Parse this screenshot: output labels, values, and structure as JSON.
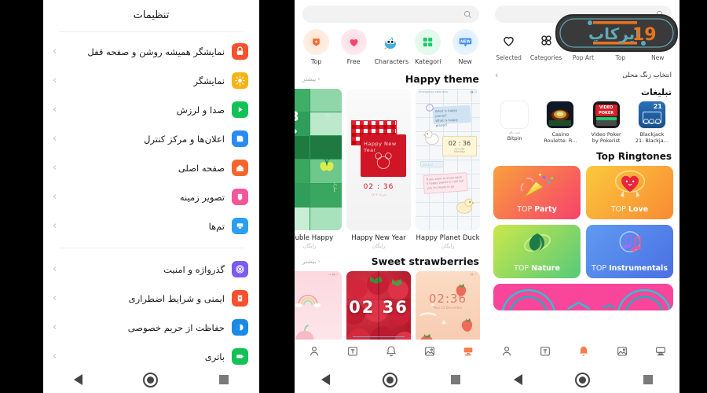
{
  "panel_settings": {
    "title": "تنظیمات",
    "groups": [
      {
        "items": [
          {
            "label": "نمایشگر همیشه روشن و صفحه قفل",
            "icon": "lock-icon",
            "color": "#f4512c"
          },
          {
            "label": "نمایشگر",
            "icon": "brightness-icon",
            "color": "#f5b417"
          },
          {
            "label": "صدا و لرزش",
            "icon": "sound-play-icon",
            "color": "#14c157"
          },
          {
            "label": "اعلان‌ها و مرکز کنترل",
            "icon": "notification-icon",
            "color": "#2a8cf0"
          },
          {
            "label": "صفحه اصلی",
            "icon": "home-icon",
            "color": "#f4662c"
          },
          {
            "label": "تصویر زمینه",
            "icon": "wallpaper-icon",
            "color": "#f4569b"
          },
          {
            "label": "تم‌ها",
            "icon": "themes-icon",
            "color": "#2a9ef0"
          }
        ]
      },
      {
        "items": [
          {
            "label": "گذرواژه و امنیت",
            "icon": "fingerprint-icon",
            "color": "#7b5cf0"
          },
          {
            "label": "ایمنی و شرایط اضطراری",
            "icon": "safety-icon",
            "color": "#f4512c"
          },
          {
            "label": "حفاظت از حریم خصوصی",
            "icon": "privacy-icon",
            "color": "#1a8ae5"
          },
          {
            "label": "باتری",
            "icon": "battery-icon",
            "color": "#14c157"
          }
        ]
      }
    ],
    "system_nav": [
      "back-triangle",
      "home-circle",
      "recents-square"
    ]
  },
  "panel_themes": {
    "search_placeholder": "",
    "search_icon": "search-icon",
    "categories": [
      {
        "label": "Top",
        "icon": "top-badge-icon",
        "color": "#f4662c"
      },
      {
        "label": "Free",
        "icon": "heart-icon",
        "color": "#f2456b"
      },
      {
        "label": "Characters",
        "icon": "bird-icon",
        "color": "#3fb0e8"
      },
      {
        "label": "Kategori",
        "icon": "grid-icon",
        "color": "#1ec96a"
      },
      {
        "label": "New",
        "icon": "new-badge-icon",
        "color": "#3a8ce8"
      }
    ],
    "sections": [
      {
        "title": "Happy theme",
        "more_label": "بیشتر",
        "items": [
          {
            "name": "Double Happy",
            "price": "رایگان",
            "art": "green-grid"
          },
          {
            "name": "Happy New Year",
            "price": "رایگان",
            "art": "red-newyear"
          },
          {
            "name": "Happy Planet Duck",
            "price": "رایگان",
            "art": "duck-notes"
          }
        ]
      },
      {
        "title": "Sweet strawberries",
        "more_label": "بیشتر",
        "items": [
          {
            "name": "",
            "price": "",
            "art": "pink-rainbow"
          },
          {
            "name": "",
            "price": "",
            "art": "strawberry-photo",
            "clock": "02 36"
          },
          {
            "name": "",
            "price": "",
            "art": "peach-strawberry",
            "clock": "02:36"
          }
        ]
      }
    ],
    "bottom_nav": [
      {
        "icon": "person-icon",
        "active": false
      },
      {
        "icon": "text-icon",
        "active": false
      },
      {
        "icon": "bell-icon",
        "active": false
      },
      {
        "icon": "image-icon",
        "active": false
      },
      {
        "icon": "theme-icon",
        "active": true
      }
    ],
    "active_color": "#f4662c",
    "system_nav": [
      "back-triangle",
      "home-circle",
      "recents-square"
    ]
  },
  "panel_ringtones": {
    "search_placeholder": "",
    "search_icon": "search-icon",
    "categories": [
      {
        "label": "Selected",
        "icon": "heart-outline-icon"
      },
      {
        "label": "Categories",
        "icon": "flower-grid-icon"
      },
      {
        "label": "Pop Art",
        "icon": "music-circle-icon",
        "color": "#b32ad6"
      },
      {
        "label": "Top",
        "icon": "bookmark-icon"
      },
      {
        "label": "New",
        "icon": "new-icon"
      }
    ],
    "subheader": {
      "title": "انتخاب زنگ محلی",
      "chevron": "chevron-left-icon"
    },
    "ads_title": "تبلیغات",
    "ads": [
      {
        "name": "Bitpin",
        "pretitle": "ثبت نام",
        "art": "blank"
      },
      {
        "name": "Casino\nRoulette: R...",
        "art": "roulette"
      },
      {
        "name": "Video Poker\nby Pokerist",
        "art": "videopoker"
      },
      {
        "name": "Blackjack\n21: Blackja...",
        "art": "blackjack"
      }
    ],
    "top_ringtones_title": "Top Ringtones",
    "tiles": [
      {
        "top": "TOP",
        "name": "Party",
        "c1": "#f9a03c",
        "c2": "#f7416c",
        "icon": "party-popper-icon"
      },
      {
        "top": "TOP",
        "name": "Love",
        "c1": "#fbc93d",
        "c2": "#f98a33",
        "icon": "heart-character-icon"
      },
      {
        "top": "TOP",
        "name": "Nature",
        "c1": "#cbe84a",
        "c2": "#56c97a",
        "icon": "leaf-icon"
      },
      {
        "top": "TOP",
        "name": "Instrumentals",
        "c1": "#5f9bf0",
        "c2": "#4a6fe3",
        "icon": "music-notes-icon"
      },
      {
        "top": "",
        "name": "",
        "c1": "#f9469b",
        "c2": "#f9469b",
        "icon": "rainbow-icon"
      }
    ],
    "bottom_nav": [
      {
        "icon": "person-icon",
        "active": false
      },
      {
        "icon": "text-icon",
        "active": false
      },
      {
        "icon": "bell-icon",
        "active": true
      },
      {
        "icon": "image-icon",
        "active": false
      },
      {
        "icon": "theme-icon",
        "active": false
      }
    ],
    "active_color": "#f4662c",
    "system_nav": [
      "back-triangle",
      "home-circle",
      "recents-square"
    ]
  },
  "watermark": {
    "text": "ایرکاپ",
    "number": "19",
    "bg": "#3a3a3a",
    "accent": "#e8731f",
    "teal": "#5fa8b8"
  }
}
